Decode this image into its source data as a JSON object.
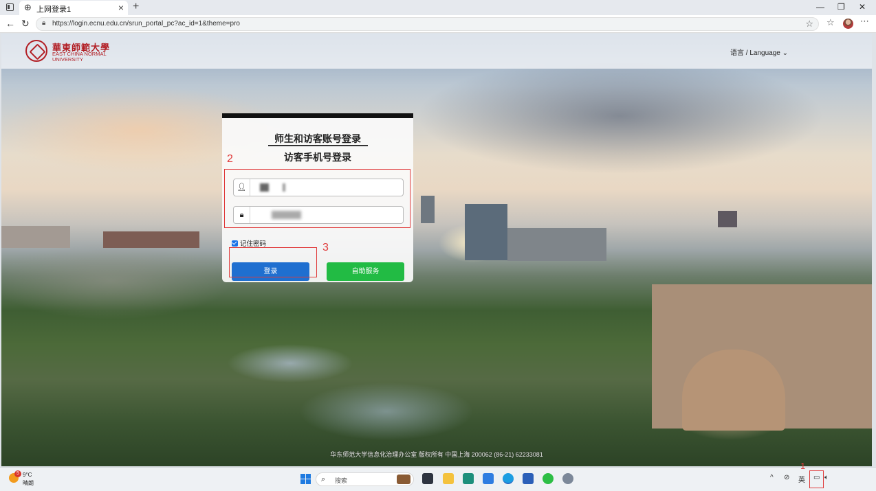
{
  "browser": {
    "tab_title": "上网登录1",
    "url": "https://login.ecnu.edu.cn/srun_portal_pc?ac_id=1&theme=pro"
  },
  "header": {
    "logo_cn": "華東師範大學",
    "logo_en": "EAST CHINA NORMAL UNIVERSITY",
    "language": "语言 / Language"
  },
  "login": {
    "tab_account": "师生和访客账号登录",
    "tab_phone": "访客手机号登录",
    "remember": "记住密码",
    "login_button": "登录",
    "self_service_button": "自助服务"
  },
  "annotations": [
    "1",
    "2",
    "3"
  ],
  "footer": "华东师范大学信息化治理办公室 版权所有 中国上海 200062 (86-21) 62233081",
  "taskbar": {
    "weather_badge": "5",
    "temperature": "9°C",
    "condition": "晴朗",
    "search_placeholder": "搜索",
    "ime": "英"
  },
  "colors": {
    "login_blue": "#1f6fd0",
    "service_green": "#22bb44",
    "brand_red": "#b21e24",
    "annotation_red": "#e03a3a"
  }
}
